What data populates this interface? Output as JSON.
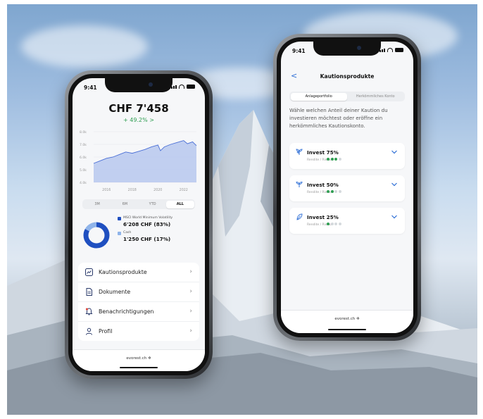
{
  "phone1": {
    "status_time": "9:41",
    "balance": "CHF 7'458",
    "performance": "+ 49.2% >",
    "chart_data": {
      "type": "area",
      "x_tick_labels": [
        "2016",
        "2018",
        "2020",
        "2022"
      ],
      "y_tick_labels": [
        "8.0k",
        "7.0k",
        "6.0k",
        "5.0k",
        "4.0k"
      ],
      "ylim": [
        4000,
        8000
      ],
      "xlim": [
        2015,
        2023
      ],
      "x": [
        2015.0,
        2015.5,
        2016.0,
        2016.5,
        2017.0,
        2017.5,
        2018.0,
        2018.5,
        2019.0,
        2019.5,
        2020.0,
        2020.2,
        2020.5,
        2021.0,
        2021.5,
        2022.0,
        2022.3,
        2022.7,
        2023.0
      ],
      "values": [
        5500,
        5700,
        5900,
        6000,
        6200,
        6400,
        6300,
        6450,
        6600,
        6800,
        6950,
        6500,
        6800,
        7000,
        7150,
        7300,
        7050,
        7200,
        6900
      ],
      "color": "#4a6fd6",
      "fill": "#b7c8ef",
      "grid": true
    },
    "range_tabs": [
      {
        "label": "3M"
      },
      {
        "label": "6M"
      },
      {
        "label": "YTD"
      },
      {
        "label": "ALL"
      }
    ],
    "allocation": [
      {
        "name": "MSCI World Minimum Volatility",
        "value": "6'208 CHF (83%)",
        "fraction": 0.83,
        "color": "#1f4fc0"
      },
      {
        "name": "Cash",
        "value": "1'250 CHF (17%)",
        "fraction": 0.17,
        "color": "#8fb4ea"
      }
    ],
    "menu": [
      {
        "label": "Kautionsprodukte",
        "icon": "chart-line-icon"
      },
      {
        "label": "Dokumente",
        "icon": "document-icon"
      },
      {
        "label": "Benachrichtigungen",
        "icon": "bell-icon"
      },
      {
        "label": "Profil",
        "icon": "user-icon"
      }
    ],
    "footer_url": "evorest.ch ✲"
  },
  "phone2": {
    "status_time": "9:41",
    "back_label": "<",
    "title": "Kautionsprodukte",
    "tabs": [
      {
        "label": "Anlageportfolio"
      },
      {
        "label": "Herkömmliches Konto"
      }
    ],
    "intro": "Wähle welchen Anteil deiner Kaution du investieren möchtest oder eröffne ein herkömmliches Kautionskonto.",
    "cards": [
      {
        "title": "Invest 75%",
        "subtitle": "Rendite / Risiko",
        "level": 3,
        "icon": "plant-large-icon"
      },
      {
        "title": "Invest 50%",
        "subtitle": "Rendite / Risiko",
        "level": 2,
        "icon": "plant-medium-icon"
      },
      {
        "title": "Invest 25%",
        "subtitle": "Rendite / Risiko",
        "level": 1,
        "icon": "leaf-icon"
      }
    ],
    "footer_url": "evorest.ch ✲"
  },
  "colors": {
    "accent": "#2f6fd6",
    "positive": "#2f9e52",
    "chart_line": "#4a6fd6"
  }
}
